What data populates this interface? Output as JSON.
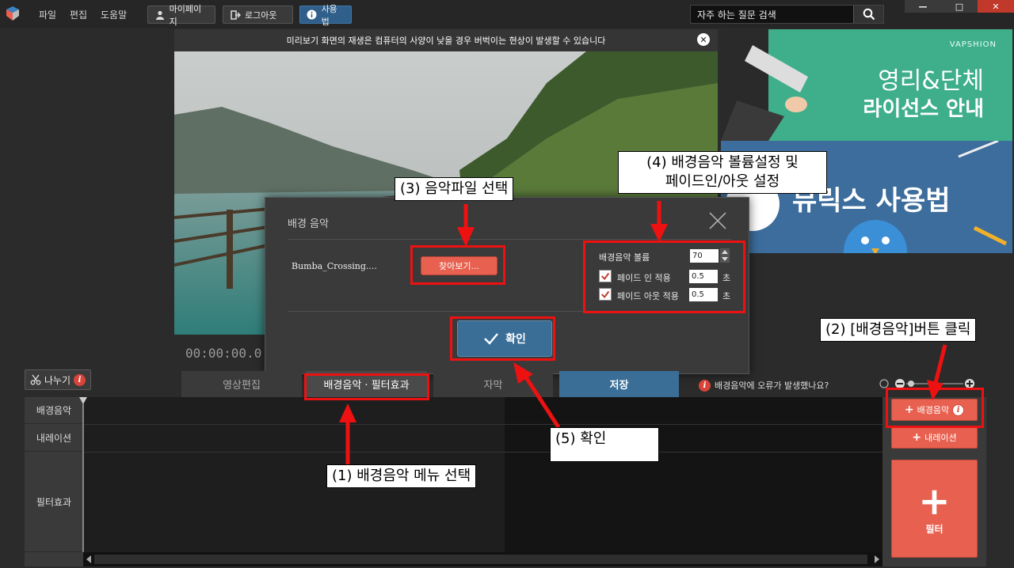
{
  "menu": {
    "file": "파일",
    "edit": "편집",
    "help": "도움말"
  },
  "top_buttons": {
    "mypage": "마이페이지",
    "logout": "로그아웃",
    "guide": "사용법"
  },
  "search": {
    "value": "자주 하는 질문 검색"
  },
  "window": {
    "minimize": "—",
    "maximize": "□",
    "close": "✕"
  },
  "preview": {
    "warning": "미리보기 화면의 재생은 컴퓨터의 사양이 낮을 경우 버벅이는 현상이 발생할 수 있습니다",
    "timecode": "00:00:00.0"
  },
  "ads": {
    "ad1_brand": "VAPSHION",
    "ad1_title1": "영리&단체",
    "ad1_title2": "라이선스 안내",
    "ad2_title": "뮤릭스 사용법"
  },
  "dialog": {
    "title": "배경 음악",
    "file_name": "Bumba_Crossing....",
    "browse_label": "찾아보기...",
    "volume_label": "배경음악 볼륨",
    "volume_value": "70",
    "fade_in_label": "페이드 인 적용",
    "fade_in_value": "0.5",
    "fade_out_label": "페이드 아웃 적용",
    "fade_out_value": "0.5",
    "unit": "초",
    "confirm_label": "확인"
  },
  "toolbar": {
    "split_label": "나누기"
  },
  "tabs": {
    "video_edit": "영상편집",
    "bgm_filter": "배경음악 · 필터효과",
    "subtitle": "자막",
    "save": "저장"
  },
  "error_link": "배경음악에 오류가 발생했나요?",
  "timeline": {
    "bgm": "배경음악",
    "narration": "내레이션",
    "filter": "필터효과"
  },
  "side_buttons": {
    "bgm": "배경음악",
    "narration": "내레이션",
    "filter": "필터"
  },
  "annotations": {
    "step1": "(1) 배경음악 메뉴 선택",
    "step2": "(2) [배경음악]버튼 클릭",
    "step3": "(3) 음악파일 선택",
    "step4_line1": "(4) 배경음악 볼륨설정 및",
    "step4_line2": "페이드인/아웃 설정",
    "step5": "(5) 확인"
  },
  "colors": {
    "accent_red": "#e8604f",
    "accent_blue": "#3a6e96",
    "annotation_red": "#ee1111"
  }
}
